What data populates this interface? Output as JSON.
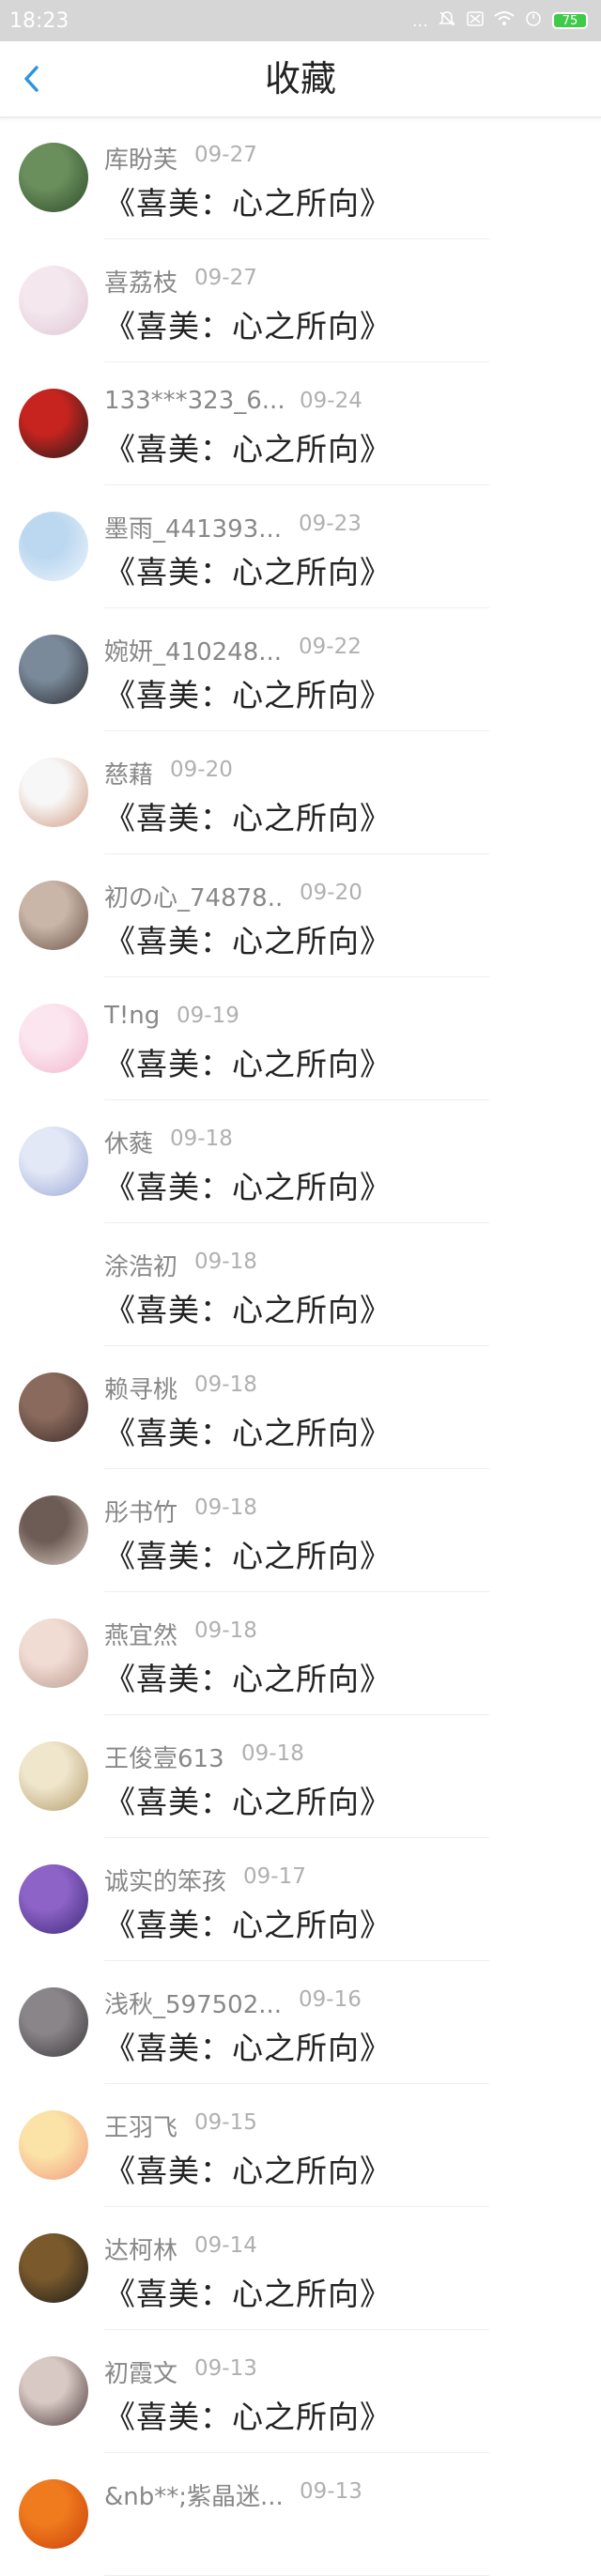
{
  "status_bar": {
    "time": "18:23",
    "signal_dots": "...",
    "battery_level": "75"
  },
  "nav": {
    "title": "收藏"
  },
  "items": [
    {
      "user": "库盼芙",
      "date": "09-27",
      "title": "《喜美：心之所向》",
      "avatar_colors": [
        "#6a8f5c",
        "#2e4a2c"
      ],
      "avatar_icon": "cactus-avatar"
    },
    {
      "user": "喜荔枝",
      "date": "09-27",
      "title": "《喜美：心之所向》",
      "avatar_colors": [
        "#f4e8ee",
        "#e0c5d5"
      ],
      "avatar_icon": "anime-girl-avatar"
    },
    {
      "user": "133***323_6...",
      "date": "09-24",
      "title": "《喜美：心之所向》",
      "avatar_colors": [
        "#c7241f",
        "#1c1c1c"
      ],
      "avatar_icon": "spiderman-avatar"
    },
    {
      "user": "墨雨_441393...",
      "date": "09-23",
      "title": "《喜美：心之所向》",
      "avatar_colors": [
        "#bcd8f0",
        "#eef5fc"
      ],
      "avatar_icon": "anime-boy-avatar"
    },
    {
      "user": "婉妍_410248...",
      "date": "09-22",
      "title": "《喜美：心之所向》",
      "avatar_colors": [
        "#7a8a9a",
        "#2a2a30"
      ],
      "avatar_icon": "ink-girl-avatar"
    },
    {
      "user": "慈藉",
      "date": "09-20",
      "title": "《喜美：心之所向》",
      "avatar_colors": [
        "#f7f7f7",
        "#d09a80"
      ],
      "avatar_icon": "man-portrait-avatar"
    },
    {
      "user": "初の心_74878...",
      "date": "09-20",
      "title": "《喜美：心之所向》",
      "avatar_colors": [
        "#c9b6a8",
        "#6b5348"
      ],
      "avatar_icon": "girl-photo-avatar"
    },
    {
      "user": "T!ng",
      "date": "09-19",
      "title": "《喜美：心之所向》",
      "avatar_colors": [
        "#fbe6ef",
        "#f3b6cc"
      ],
      "avatar_icon": "pink-cartoon-avatar"
    },
    {
      "user": "休蕤",
      "date": "09-18",
      "title": "《喜美：心之所向》",
      "avatar_colors": [
        "#e3e8f6",
        "#9aa7d6"
      ],
      "avatar_icon": "anime-maid-avatar"
    },
    {
      "user": "涂浩初",
      "date": "09-18",
      "title": "《喜美：心之所向》",
      "avatar_colors": [
        "#ffffff",
        "#ffffff"
      ],
      "avatar_icon": "blank-avatar"
    },
    {
      "user": "赖寻桃",
      "date": "09-18",
      "title": "《喜美：心之所向》",
      "avatar_colors": [
        "#8a6a5c",
        "#3a2a28"
      ],
      "avatar_icon": "dark-photo-avatar"
    },
    {
      "user": "彤书竹",
      "date": "09-18",
      "title": "《喜美：心之所向》",
      "avatar_colors": [
        "#6d5c55",
        "#ddd0c6"
      ],
      "avatar_icon": "girl-hat-avatar"
    },
    {
      "user": "燕宜然",
      "date": "09-18",
      "title": "《喜美：心之所向》",
      "avatar_colors": [
        "#f1dcd4",
        "#b99a8e"
      ],
      "avatar_icon": "girl-face-avatar"
    },
    {
      "user": "王俊壹613",
      "date": "09-18",
      "title": "《喜美：心之所向》",
      "avatar_colors": [
        "#efe6cc",
        "#b39a6a"
      ],
      "avatar_icon": "calligraphy-avatar"
    },
    {
      "user": "诚实的笨孩",
      "date": "09-17",
      "title": "《喜美：心之所向》",
      "avatar_colors": [
        "#8e63c7",
        "#3b2a7a"
      ],
      "avatar_icon": "purple-anime-avatar"
    },
    {
      "user": "浅秋_597502...",
      "date": "09-16",
      "title": "《喜美：心之所向》",
      "avatar_colors": [
        "#8a8589",
        "#3a383c"
      ],
      "avatar_icon": "grey-art-avatar"
    },
    {
      "user": "王羽飞",
      "date": "09-15",
      "title": "《喜美：心之所向》",
      "avatar_colors": [
        "#fbe3a8",
        "#f19a7e"
      ],
      "avatar_icon": "blonde-anime-avatar"
    },
    {
      "user": "达柯林",
      "date": "09-14",
      "title": "《喜美：心之所向》",
      "avatar_colors": [
        "#7a5a2c",
        "#1a1a1a"
      ],
      "avatar_icon": "bird-avatar"
    },
    {
      "user": "初霞文",
      "date": "09-13",
      "title": "《喜美：心之所向》",
      "avatar_colors": [
        "#d9c9c4",
        "#4b3a3a"
      ],
      "avatar_icon": "long-hair-avatar"
    },
    {
      "user": "&nb**;紫晶迷...",
      "date": "09-13",
      "title": "",
      "avatar_colors": [
        "#f07a1e",
        "#c8400a"
      ],
      "avatar_icon": "orange-avatar"
    }
  ],
  "colors": {
    "status_bar_bg": "#d6d6d6",
    "accent_back": "#2f93e0",
    "username": "#888888",
    "date": "#b0b0b0",
    "title": "#222222"
  }
}
